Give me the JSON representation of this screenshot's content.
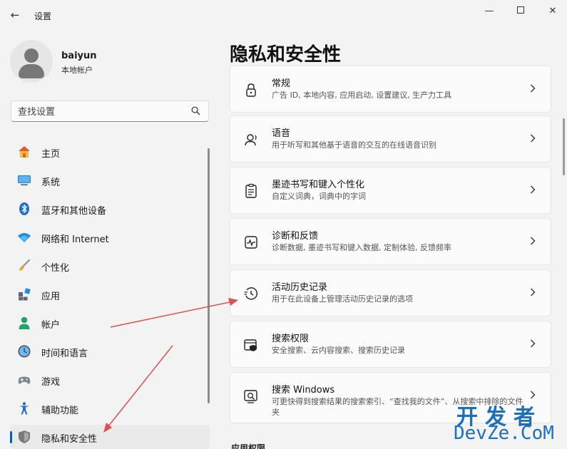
{
  "window": {
    "back_label": "←",
    "title": "设置",
    "min_label": "—",
    "close_label": "✕"
  },
  "user": {
    "name": "baiyun",
    "account_type": "本地帐户"
  },
  "search": {
    "placeholder": "查找设置"
  },
  "sidebar": {
    "items": [
      {
        "label": "主页",
        "icon": "home-icon"
      },
      {
        "label": "系统",
        "icon": "system-monitor-icon"
      },
      {
        "label": "蓝牙和其他设备",
        "icon": "bluetooth-icon"
      },
      {
        "label": "网络和 Internet",
        "icon": "wifi-icon"
      },
      {
        "label": "个性化",
        "icon": "brush-icon"
      },
      {
        "label": "应用",
        "icon": "apps-icon"
      },
      {
        "label": "帐户",
        "icon": "account-icon"
      },
      {
        "label": "时间和语言",
        "icon": "clock-globe-icon"
      },
      {
        "label": "游戏",
        "icon": "gamepad-icon"
      },
      {
        "label": "辅助功能",
        "icon": "accessibility-icon"
      },
      {
        "label": "隐私和安全性",
        "icon": "shield-icon",
        "active": true
      }
    ]
  },
  "main": {
    "title": "隐私和安全性",
    "cards": [
      {
        "title": "常规",
        "subtitle": "广告 ID, 本地内容, 应用启动, 设置建议, 生产力工具",
        "icon": "lock-icon"
      },
      {
        "title": "语音",
        "subtitle": "用于听写和其他基于语音的交互的在线语音识别",
        "icon": "speech-icon"
      },
      {
        "title": "墨迹书写和键入个性化",
        "subtitle": "自定义词典，词典中的字词",
        "icon": "clipboard-list-icon"
      },
      {
        "title": "诊断和反馈",
        "subtitle": "诊断数据, 墨迹书写和键入数据, 定制体验, 反馈频率",
        "icon": "pulse-icon"
      },
      {
        "title": "活动历史记录",
        "subtitle": "用于在此设备上管理活动历史记录的选项",
        "icon": "history-icon"
      },
      {
        "title": "搜索权限",
        "subtitle": "安全搜索、云内容搜索、搜索历史记录",
        "icon": "search-shield-icon"
      },
      {
        "title": "搜索 Windows",
        "subtitle": "可更快得到搜索结果的搜索索引、“查找我的文件”、从搜索中排除的文件夹",
        "icon": "search-windows-icon"
      }
    ],
    "section_label": "应用权限"
  },
  "watermark": {
    "line1": "开发者",
    "line2": "DevZe.CoM"
  },
  "colors": {
    "accent": "#005fb8",
    "annotation_arrow": "#d9534f"
  }
}
